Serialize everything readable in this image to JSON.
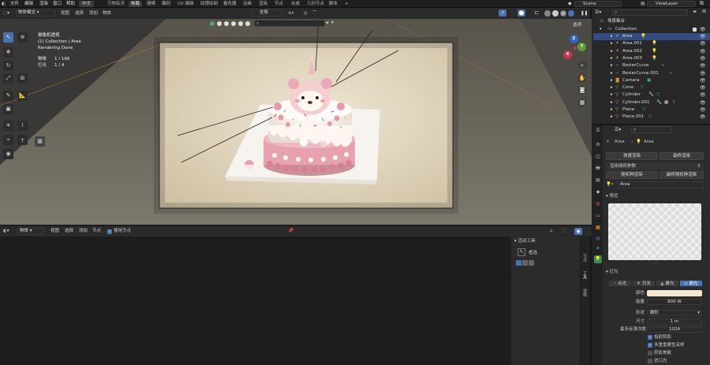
{
  "menu": {
    "file": "文件",
    "edit": "编辑",
    "render": "渲染",
    "window": "窗口",
    "help": "帮助",
    "lang": "中文"
  },
  "workspaces": [
    "万物有灵",
    "布局",
    "建模",
    "雕刻",
    "UV 编辑",
    "纹理绘制",
    "着色器",
    "动画",
    "渲染",
    "节点",
    "合成",
    "几何节点",
    "脚本"
  ],
  "workspaces_plus": "+",
  "scene_name": "Scene",
  "view_layer": "ViewLayer",
  "viewport_header": {
    "mode": "物体模式",
    "view": "视图",
    "select": "选择",
    "add": "添加",
    "object": "物体",
    "transform": "全局",
    "options": "选项"
  },
  "overlay_info": {
    "line1": "摄像机透视",
    "line2": "(1) Collection | Area",
    "line3": "Rendering Done",
    "objects_label": "物体",
    "objects_val": "1 / 166",
    "lights_label": "灯光",
    "lights_val": "1 / 4"
  },
  "gizmo": {
    "z": "Z",
    "y": "Y",
    "x": "X"
  },
  "node_editor": {
    "type": "物体",
    "view": "视图",
    "select": "选择",
    "add": "添加",
    "node": "节点",
    "use_nodes": "使用节点"
  },
  "sidebar": {
    "title": "活动工具",
    "select_box": "框选"
  },
  "outliner": {
    "root": "场景集合",
    "items": [
      {
        "name": "Collection",
        "selected": false
      },
      {
        "name": "Area",
        "selected": true
      },
      {
        "name": "Area.001",
        "selected": false
      },
      {
        "name": "Area.002",
        "selected": false
      },
      {
        "name": "Area.003",
        "selected": false
      },
      {
        "name": "BezierCurve",
        "selected": false
      },
      {
        "name": "BezierCurve.001",
        "selected": false
      },
      {
        "name": "Camera",
        "selected": false
      },
      {
        "name": "Cone",
        "selected": false
      },
      {
        "name": "Cylinder",
        "selected": false
      },
      {
        "name": "Cylinder.001",
        "selected": false
      },
      {
        "name": "Plane",
        "selected": false
      },
      {
        "name": "Plane.001",
        "selected": false
      }
    ]
  },
  "properties": {
    "breadcrumb_1": "Area",
    "breadcrumb_2": "Area",
    "quick_render": "快速渲染",
    "final_render": "最终渲染",
    "random_seed": "渲染随机种数",
    "random_seed_val": "3",
    "random_render": "随机种渲染",
    "final_random_render": "最终随机种渲染",
    "datablock": "Area",
    "preview_label": "预览",
    "light_section": "灯光",
    "light_types": [
      "点光",
      "日光",
      "聚光",
      "面光"
    ],
    "color_label": "颜色",
    "power_label": "能量",
    "power_val": "800 W",
    "shape_label": "形状",
    "shape_val": "碟形",
    "size_label": "尺寸",
    "size_val": "1 m",
    "bounces_label": "最多反弹次数",
    "bounces_val": "1024",
    "cast_shadow": "投射阴影",
    "multiple_importance": "多重重要性采样",
    "shadow_caustics": "阴影焦散",
    "portal": "进口光"
  },
  "colors": {
    "accent": "#4772b3",
    "light_color": "#f4e6cf",
    "background": "#1d1d1d"
  }
}
